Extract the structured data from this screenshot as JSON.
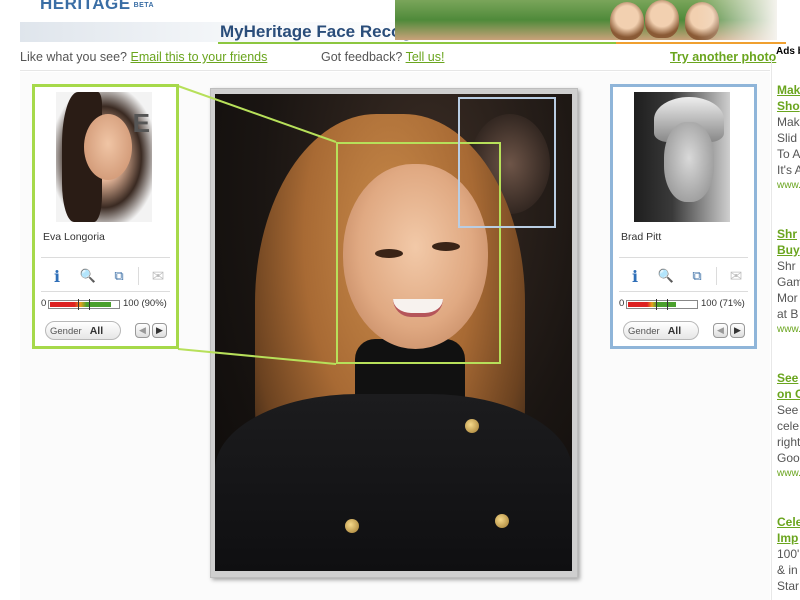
{
  "header": {
    "logo_text": "HERITAGE",
    "logo_badge": "BETA",
    "app_title": "MyHeritage Face Recognition"
  },
  "subheader": {
    "like_text": "Like what you see?",
    "email_link": "Email this to your friends",
    "feedback_text": "Got feedback?",
    "tell_link": "Tell us!",
    "try_link": "Try another photo"
  },
  "matches": [
    {
      "name": "Eva Longoria",
      "meter_low": "0",
      "meter_high": "100 (90%)",
      "score": 0.9,
      "gender_label": "Gender",
      "gender_value": "All",
      "prev": "◀",
      "next": "▶"
    },
    {
      "name": "Brad Pitt",
      "meter_low": "0",
      "meter_high": "100 (71%)",
      "score": 0.71,
      "gender_label": "Gender",
      "gender_value": "All",
      "prev": "◀",
      "next": "▶"
    }
  ],
  "match_thumb_text": {
    "eva": "E"
  },
  "tools": {
    "info": "i",
    "search": "🔍",
    "compare": "⧉",
    "mail": "✉"
  },
  "ads": {
    "label": "Ads b",
    "items": [
      {
        "head1": "Mak",
        "head2": "Sho",
        "lines": [
          "Mak",
          "Slid",
          "To A",
          "It's A"
        ],
        "url": "www."
      },
      {
        "head1": "Shr",
        "head2": "Buy",
        "lines": [
          "Shr",
          "Gam",
          "Mor",
          "at B"
        ],
        "url": "www."
      },
      {
        "head1": "See",
        "head2": "on C",
        "lines": [
          "See",
          "cele",
          "right",
          "Goo"
        ],
        "url": "www."
      },
      {
        "head1": "Cele",
        "head2": "Imp",
        "lines": [
          "100'",
          "& in",
          "Star"
        ],
        "url": ""
      }
    ]
  },
  "colors": {
    "accent_green": "#8cc63f",
    "link_green": "#6aa51e",
    "title_blue": "#2a4d7a",
    "match1_border": "#a6d94a",
    "match2_border": "#8fb5d9"
  }
}
